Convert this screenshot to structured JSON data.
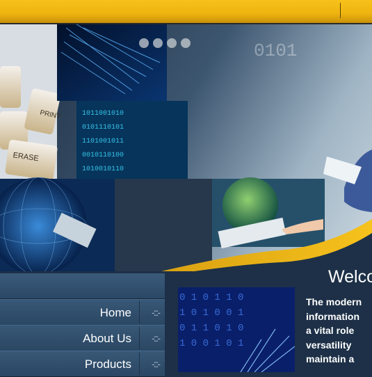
{
  "header": {
    "bar_color": "#f2b815"
  },
  "banner": {
    "slide_dots": 4
  },
  "welcome": {
    "title": "Welco"
  },
  "nav": {
    "items": [
      {
        "label": "Home",
        "arrow": "-:::-"
      },
      {
        "label": "About Us",
        "arrow": "-:::-"
      },
      {
        "label": "Products",
        "arrow": "-:::-"
      }
    ]
  },
  "content": {
    "lines": [
      "The modern",
      "information",
      "a vital role",
      "versatility",
      "maintain a"
    ]
  },
  "colors": {
    "accent": "#f2b815",
    "nav_bg": "#2f4e6d",
    "page_bg": "#1d3047"
  }
}
